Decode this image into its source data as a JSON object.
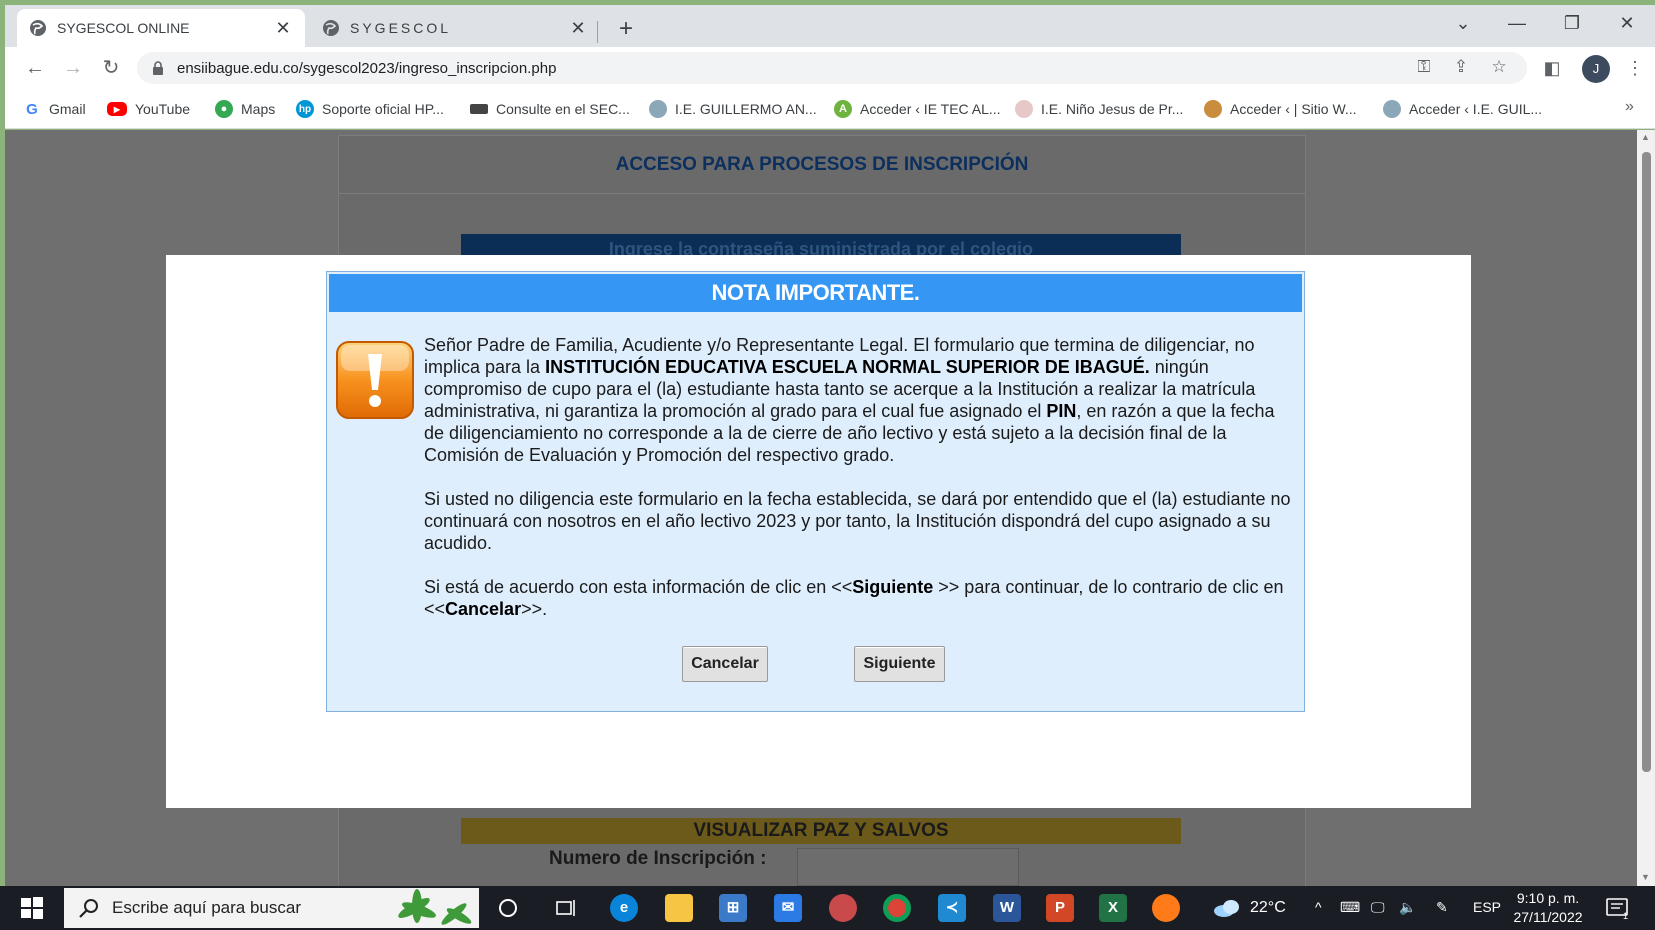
{
  "browser": {
    "tabs": [
      {
        "title": "SYGESCOL ONLINE",
        "active": true
      },
      {
        "title": "SYGESCOL",
        "active": false
      }
    ],
    "url": "ensiibague.edu.co/sygescol2023/ingreso_inscripcion.php",
    "profile_initial": "J",
    "bookmarks": [
      {
        "label": "Gmail",
        "icon": "google-icon"
      },
      {
        "label": "YouTube",
        "icon": "youtube-icon"
      },
      {
        "label": "Maps",
        "icon": "maps-pin-icon"
      },
      {
        "label": "Soporte oficial HP...",
        "icon": "hp-icon"
      },
      {
        "label": "Consulte en el SEC...",
        "icon": "sec-icon"
      },
      {
        "label": "I.E. GUILLERMO AN...",
        "icon": "school-icon"
      },
      {
        "label": "Acceder ‹ IE TEC AL...",
        "icon": "school-icon"
      },
      {
        "label": "I.E. Niño Jesus de Pr...",
        "icon": "school-icon"
      },
      {
        "label": "Acceder ‹ | Sitio W...",
        "icon": "school-icon"
      },
      {
        "label": "Acceder ‹ I.E. GUIL...",
        "icon": "school-icon"
      }
    ]
  },
  "page": {
    "header": "ACCESO PARA PROCESOS DE INSCRIPCIÓN",
    "password_prompt": "Ingrese la contraseña suministrada por el colegio",
    "paz_salvos": "VISUALIZAR PAZ Y SALVOS",
    "inscripcion_label": "Numero de Inscripción :"
  },
  "modal": {
    "title": "NOTA IMPORTANTE.",
    "p1": {
      "a": "Señor Padre de Familia, Acudiente y/o Representante Legal. El formulario que termina de diligenciar, no implica para la ",
      "b": "INSTITUCIÓN EDUCATIVA ESCUELA NORMAL SUPERIOR DE IBAGUÉ.",
      "c": " ningún compromiso de cupo para el (la) estudiante hasta tanto se acerque a la Institución a realizar la matrícula administrativa, ni garantiza la promoción al grado para el cual fue asignado el ",
      "d": "PIN",
      "e": ", en razón a que la fecha de diligenciamiento no corresponde a la de cierre de año lectivo y está sujeto a la decisión final de la Comisión de Evaluación y Promoción del respectivo grado."
    },
    "p2": "Si usted no diligencia este formulario en la fecha establecida, se dará por entendido que el (la) estudiante no continuará con nosotros en el año lectivo 2023  y por tanto,  la Institución dispondrá del cupo asignado a su acudido.",
    "p3": {
      "a": "Si está de acuerdo con esta información de clic en <<",
      "b": "Siguiente",
      "c": " >>  para continuar, de lo contrario de clic en <<",
      "d": "Cancelar",
      "e": ">>."
    },
    "cancel_label": "Cancelar",
    "next_label": "Siguiente"
  },
  "taskbar": {
    "search_placeholder": "Escribe aquí para buscar",
    "temperature": "22°C",
    "language": "ESP",
    "time": "9:10 p. m.",
    "date": "27/11/2022",
    "notification_count": "1"
  },
  "colors": {
    "modal_header": "#3596f3",
    "modal_body": "#dfeefd",
    "page_header_text": "#0c2f5e"
  }
}
